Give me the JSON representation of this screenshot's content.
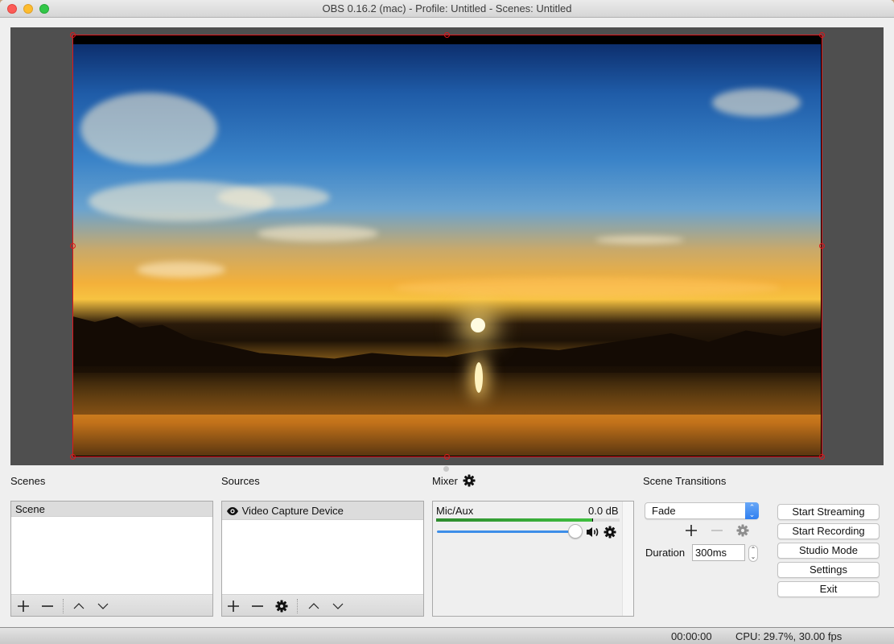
{
  "window": {
    "title": "OBS 0.16.2 (mac) - Profile: Untitled - Scenes: Untitled"
  },
  "preview": {
    "source_content": "sunset-lake-photo",
    "selection_color": "#e0151a",
    "background_color": "#4f4f4f"
  },
  "scenes": {
    "label": "Scenes",
    "items": [
      {
        "name": "Scene",
        "selected": true
      }
    ],
    "toolbar": {
      "add": "add-icon",
      "remove": "remove-icon",
      "move_up": "chevron-up-icon",
      "move_down": "chevron-down-icon"
    }
  },
  "sources": {
    "label": "Sources",
    "items": [
      {
        "name": "Video Capture Device",
        "visible": true,
        "selected": true
      }
    ],
    "toolbar": {
      "add": "add-icon",
      "remove": "remove-icon",
      "properties": "gear-icon",
      "move_up": "chevron-up-icon",
      "move_down": "chevron-down-icon"
    }
  },
  "mixer": {
    "label": "Mixer",
    "channels": [
      {
        "name": "Mic/Aux",
        "db_label": "0.0 dB",
        "meter_level": 0.85,
        "volume": 1.0,
        "muted": false
      }
    ],
    "colors": {
      "meter": "#3fbf3f",
      "slider": "#3d8ee8"
    }
  },
  "transitions": {
    "label": "Scene Transitions",
    "selected": "Fade",
    "duration_label": "Duration",
    "duration_value": "300ms"
  },
  "controls": {
    "start_streaming": "Start Streaming",
    "start_recording": "Start Recording",
    "studio_mode": "Studio Mode",
    "settings": "Settings",
    "exit": "Exit"
  },
  "status": {
    "time": "00:00:00",
    "cpu_fps": "CPU: 29.7%, 30.00 fps"
  }
}
